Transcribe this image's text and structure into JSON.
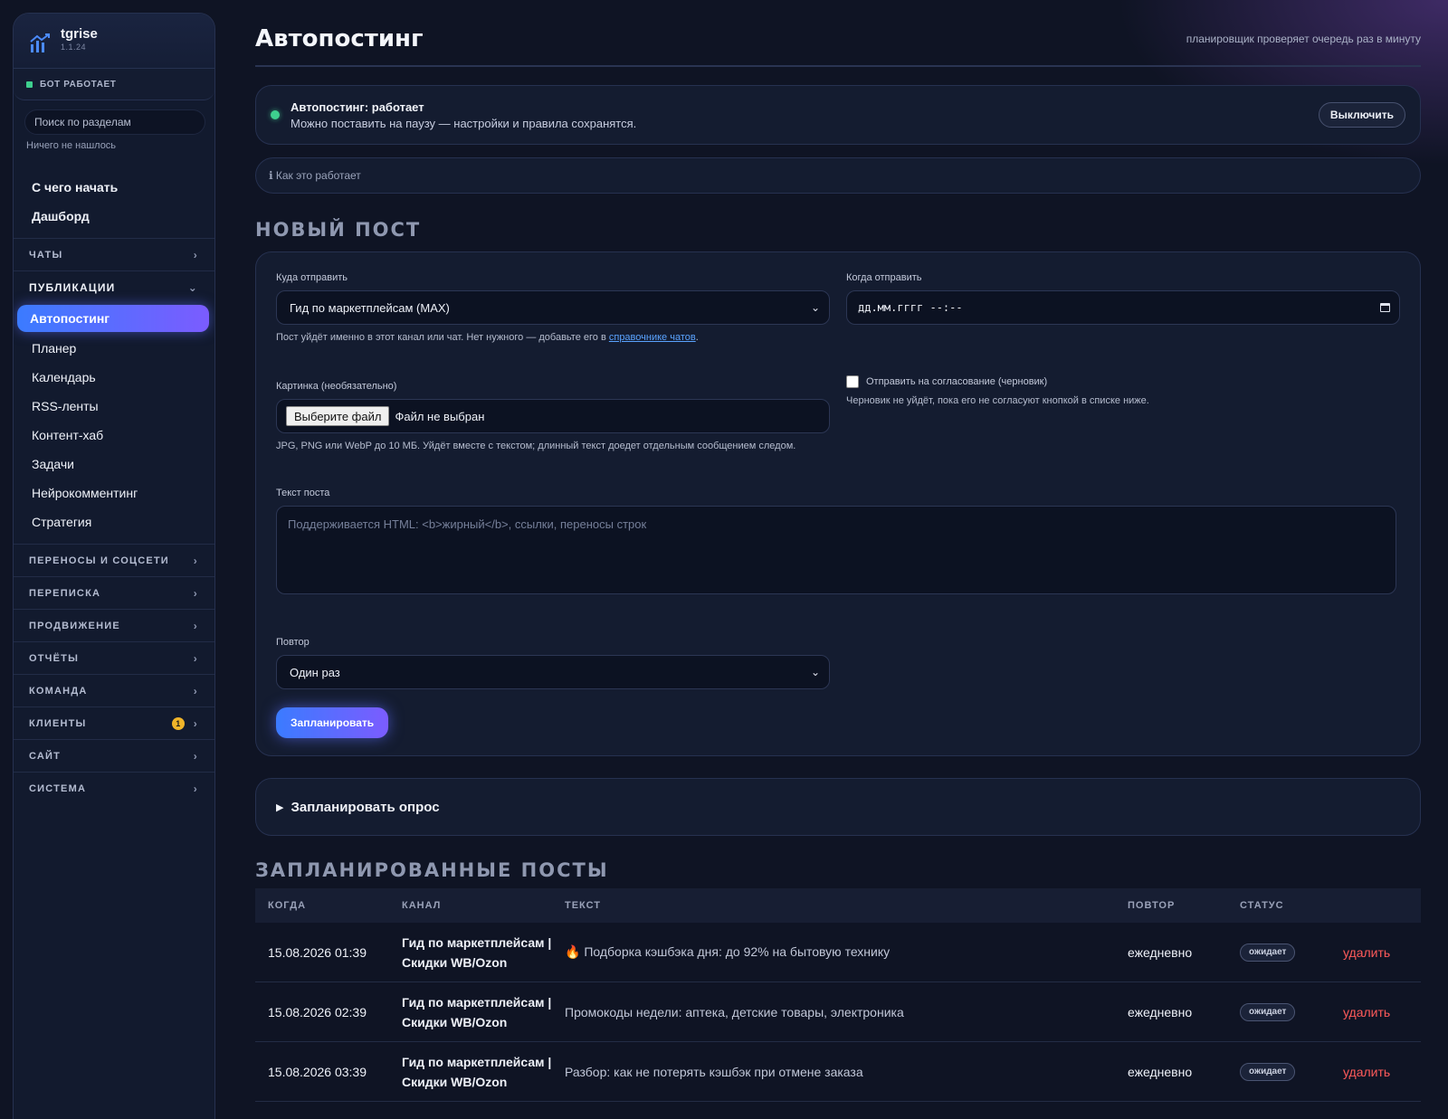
{
  "brand": {
    "name": "tgrise",
    "version": "1.1.24"
  },
  "bot_status": "БОТ РАБОТАЕТ",
  "search": {
    "placeholder": "Поиск по разделам",
    "empty": "Ничего не нашлось"
  },
  "nav": {
    "start": "С чего начать",
    "dashboard": "Дашборд",
    "sections_before": [
      {
        "label": "ЧАТЫ"
      }
    ],
    "publications": {
      "label": "ПУБЛИКАЦИИ",
      "active": "Автопостинг",
      "items": [
        {
          "label": "Планер"
        },
        {
          "label": "Календарь"
        },
        {
          "label": "RSS-ленты"
        },
        {
          "label": "Контент-хаб"
        },
        {
          "label": "Задачи"
        },
        {
          "label": "Нейрокомментинг"
        },
        {
          "label": "Стратегия"
        }
      ]
    },
    "sections_after": [
      {
        "label": "ПЕРЕНОСЫ И СОЦСЕТИ"
      },
      {
        "label": "ПЕРЕПИСКА"
      },
      {
        "label": "ПРОДВИЖЕНИЕ"
      },
      {
        "label": "ОТЧЁТЫ"
      },
      {
        "label": "КОМАНДА"
      },
      {
        "label": "КЛИЕНТЫ",
        "badge": "1"
      },
      {
        "label": "САЙТ"
      },
      {
        "label": "СИСТЕМА"
      }
    ]
  },
  "header": {
    "title": "Автопостинг",
    "hint": "планировщик проверяет очередь раз в минуту"
  },
  "autopost": {
    "title": "Автопостинг: работает",
    "subtitle": "Можно поставить на паузу — настройки и правила сохранятся.",
    "off_button": "Выключить"
  },
  "howto": "ℹ Как это работает",
  "new_post": {
    "section_title": "НОВЫЙ ПОСТ",
    "target_label": "Куда отправить",
    "target_value": "Гид по маркетплейсам (MAX)",
    "target_help": "Пост уйдёт именно в этот канал или чат. Нет нужного — добавьте его в",
    "target_help_link": "справочнике чатов",
    "target_help_end": ".",
    "when_label": "Когда отправить",
    "when_placeholder": "дд.мм.гггг --:--",
    "image_label": "Картинка (необязательно)",
    "file_button": "Выберите файл",
    "file_none": "Файл не выбран",
    "image_help": "JPG, PNG или WebP до 10 МБ. Уйдёт вместе с текстом; длинный текст доедет отдельным сообщением следом.",
    "approval_label": "Отправить на согласование (черновик)",
    "approval_help": "Черновик не уйдёт, пока его не согласуют кнопкой в списке ниже.",
    "text_label": "Текст поста",
    "text_placeholder": "Поддерживается HTML: <b>жирный</b>, ссылки, переносы строк",
    "repeat_label": "Повтор",
    "repeat_value": "Один раз",
    "submit": "Запланировать"
  },
  "poll": {
    "label": "Запланировать опрос"
  },
  "scheduled": {
    "section_title": "ЗАПЛАНИРОВАННЫЕ ПОСТЫ",
    "columns": [
      "КОГДА",
      "КАНАЛ",
      "ТЕКСТ",
      "ПОВТОР",
      "СТАТУС"
    ],
    "rows": [
      {
        "when": "15.08.2026 01:39",
        "channel_1": "Гид по маркетплейсам |",
        "channel_2": "Скидки WB/Ozon",
        "text": "🔥 Подборка кэшбэка дня: до 92% на бытовую технику",
        "repeat": "ежедневно",
        "status": "ожидает",
        "action": "удалить"
      },
      {
        "when": "15.08.2026 02:39",
        "channel_1": "Гид по маркетплейсам |",
        "channel_2": "Скидки WB/Ozon",
        "text": "Промокоды недели: аптека, детские товары, электроника",
        "repeat": "ежедневно",
        "status": "ожидает",
        "action": "удалить"
      },
      {
        "when": "15.08.2026 03:39",
        "channel_1": "Гид по маркетплейсам |",
        "channel_2": "Скидки WB/Ozon",
        "text": "Разбор: как не потерять кэшбэк при отмене заказа",
        "repeat": "ежедневно",
        "status": "ожидает",
        "action": "удалить"
      }
    ]
  },
  "colors": {
    "accent_start": "#3b7bff",
    "accent_end": "#7b5cff",
    "ok": "#3ecf8e",
    "danger": "#ff5a5a",
    "badge": "#f0b429"
  }
}
